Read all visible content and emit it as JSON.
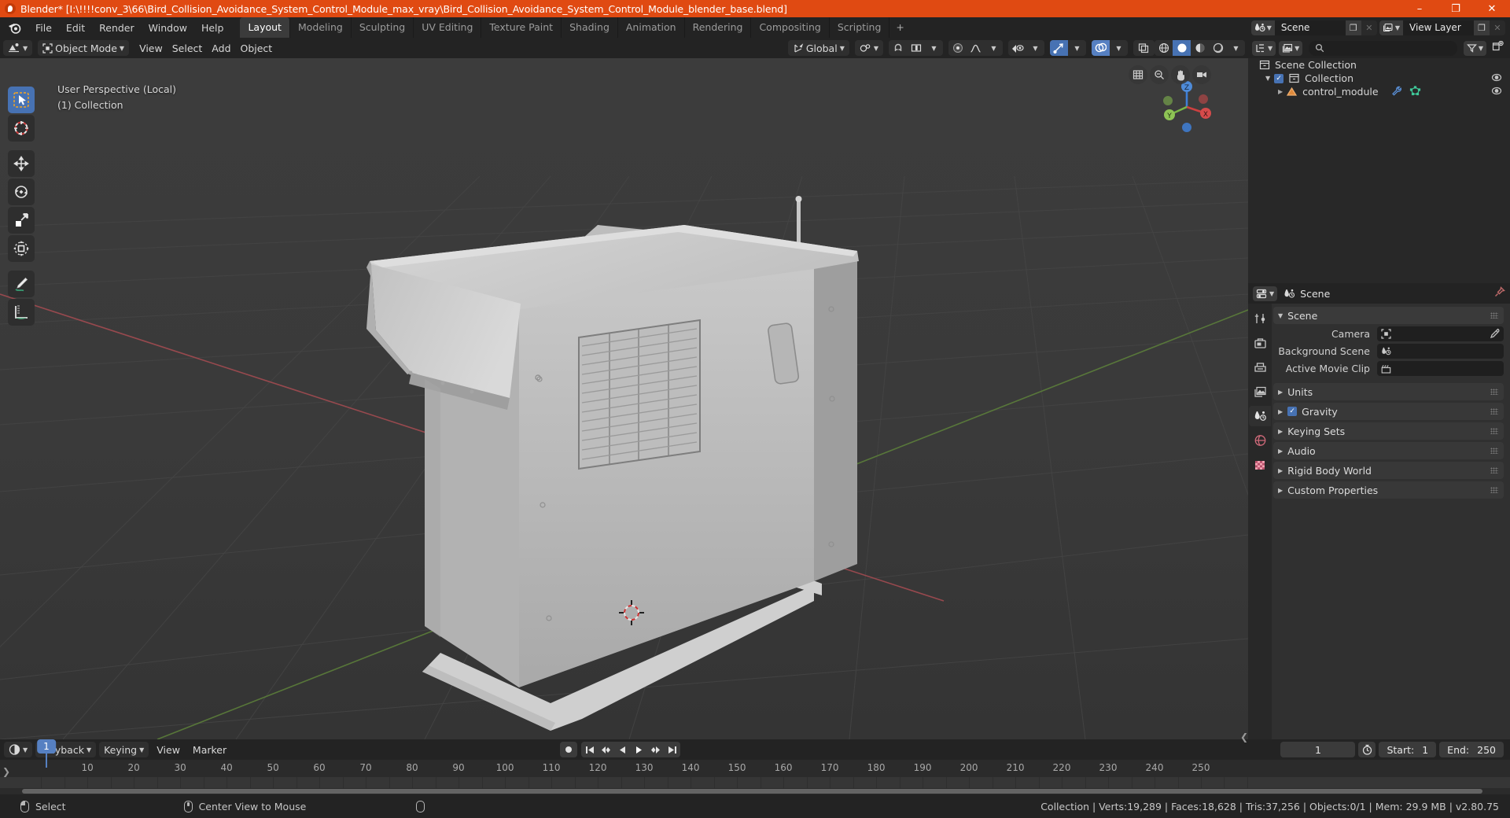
{
  "window": {
    "title": "Blender* [I:\\!!!!conv_3\\66\\Bird_Collision_Avoidance_System_Control_Module_max_vray\\Bird_Collision_Avoidance_System_Control_Module_blender_base.blend]",
    "minimize": "–",
    "maximize": "❐",
    "close": "✕",
    "accent": "#e04a12"
  },
  "topbar": {
    "menus": [
      "File",
      "Edit",
      "Render",
      "Window",
      "Help"
    ],
    "workspaces": [
      {
        "label": "Layout",
        "active": true
      },
      {
        "label": "Modeling",
        "active": false
      },
      {
        "label": "Sculpting",
        "active": false
      },
      {
        "label": "UV Editing",
        "active": false
      },
      {
        "label": "Texture Paint",
        "active": false
      },
      {
        "label": "Shading",
        "active": false
      },
      {
        "label": "Animation",
        "active": false
      },
      {
        "label": "Rendering",
        "active": false
      },
      {
        "label": "Compositing",
        "active": false
      },
      {
        "label": "Scripting",
        "active": false
      }
    ],
    "add_workspace": "+",
    "scene_name": "Scene",
    "view_layer_name": "View Layer"
  },
  "viewport": {
    "mode": "Object Mode",
    "menus": [
      "View",
      "Select",
      "Add",
      "Object"
    ],
    "transform_orientation": "Global",
    "overlay_text_line1": "User Perspective (Local)",
    "overlay_text_line2": "(1) Collection",
    "gizmo_axes": {
      "x": "X",
      "y": "Y",
      "z": "Z"
    },
    "tools": [
      {
        "name": "tweak-select-tool",
        "active": true
      },
      {
        "name": "cursor-tool",
        "active": false
      },
      {
        "name": "move-tool",
        "active": false
      },
      {
        "name": "rotate-tool",
        "active": false
      },
      {
        "name": "scale-tool",
        "active": false
      },
      {
        "name": "transform-tool",
        "active": false
      },
      {
        "name": "annotate-tool",
        "active": false
      },
      {
        "name": "measure-tool",
        "active": false
      }
    ]
  },
  "outliner": {
    "search_placeholder": "",
    "rows": [
      {
        "label": "Scene Collection",
        "indent": 0,
        "icon": "collection-icon",
        "eye": false,
        "checkbox": false,
        "disclosure": ""
      },
      {
        "label": "Collection",
        "indent": 1,
        "icon": "collection-icon",
        "eye": true,
        "checkbox": true,
        "disclosure": "▼"
      },
      {
        "label": "control_module",
        "indent": 2,
        "icon": "mesh-object-icon",
        "eye": true,
        "checkbox": false,
        "disclosure": "▶"
      }
    ]
  },
  "properties": {
    "breadcrumb": "Scene",
    "panels": [
      {
        "label": "Scene",
        "open": true,
        "checkbox": false
      },
      {
        "label": "Units",
        "open": false,
        "checkbox": false
      },
      {
        "label": "Gravity",
        "open": false,
        "checkbox": true
      },
      {
        "label": "Keying Sets",
        "open": false,
        "checkbox": false
      },
      {
        "label": "Audio",
        "open": false,
        "checkbox": false
      },
      {
        "label": "Rigid Body World",
        "open": false,
        "checkbox": false
      },
      {
        "label": "Custom Properties",
        "open": false,
        "checkbox": false
      }
    ],
    "scene_fields": [
      {
        "label": "Camera",
        "value": "",
        "icon": "camera-icon",
        "eyedropper": true
      },
      {
        "label": "Background Scene",
        "value": "",
        "icon": "scene-icon",
        "eyedropper": false
      },
      {
        "label": "Active Movie Clip",
        "value": "",
        "icon": "clip-icon",
        "eyedropper": false
      }
    ],
    "tabs": [
      {
        "name": "tool-tab",
        "active": false
      },
      {
        "name": "render-tab",
        "active": false
      },
      {
        "name": "output-tab",
        "active": false
      },
      {
        "name": "view-layer-tab",
        "active": false
      },
      {
        "name": "scene-tab",
        "active": true
      },
      {
        "name": "world-tab",
        "active": false
      },
      {
        "name": "texture-tab",
        "active": false
      }
    ]
  },
  "timeline": {
    "menus": [
      "Playback",
      "Keying",
      "View",
      "Marker"
    ],
    "current_frame": "1",
    "start_label": "Start:",
    "start_value": "1",
    "end_label": "End:",
    "end_value": "250",
    "tick_labels": [
      "1",
      "10",
      "20",
      "30",
      "40",
      "50",
      "60",
      "70",
      "80",
      "90",
      "100",
      "110",
      "120",
      "130",
      "140",
      "150",
      "160",
      "170",
      "180",
      "190",
      "200",
      "210",
      "220",
      "230",
      "240",
      "250"
    ]
  },
  "statusbar": {
    "left_items": [
      {
        "icon": "mouse-left-icon",
        "label": "Select"
      },
      {
        "icon": "mouse-middle-icon",
        "label": "Center View to Mouse"
      },
      {
        "icon": "mouse-right-icon",
        "label": ""
      }
    ],
    "stats": "Collection | Verts:19,289 | Faces:18,628 | Tris:37,256 | Objects:0/1 | Mem: 29.9 MB | v2.80.75"
  }
}
